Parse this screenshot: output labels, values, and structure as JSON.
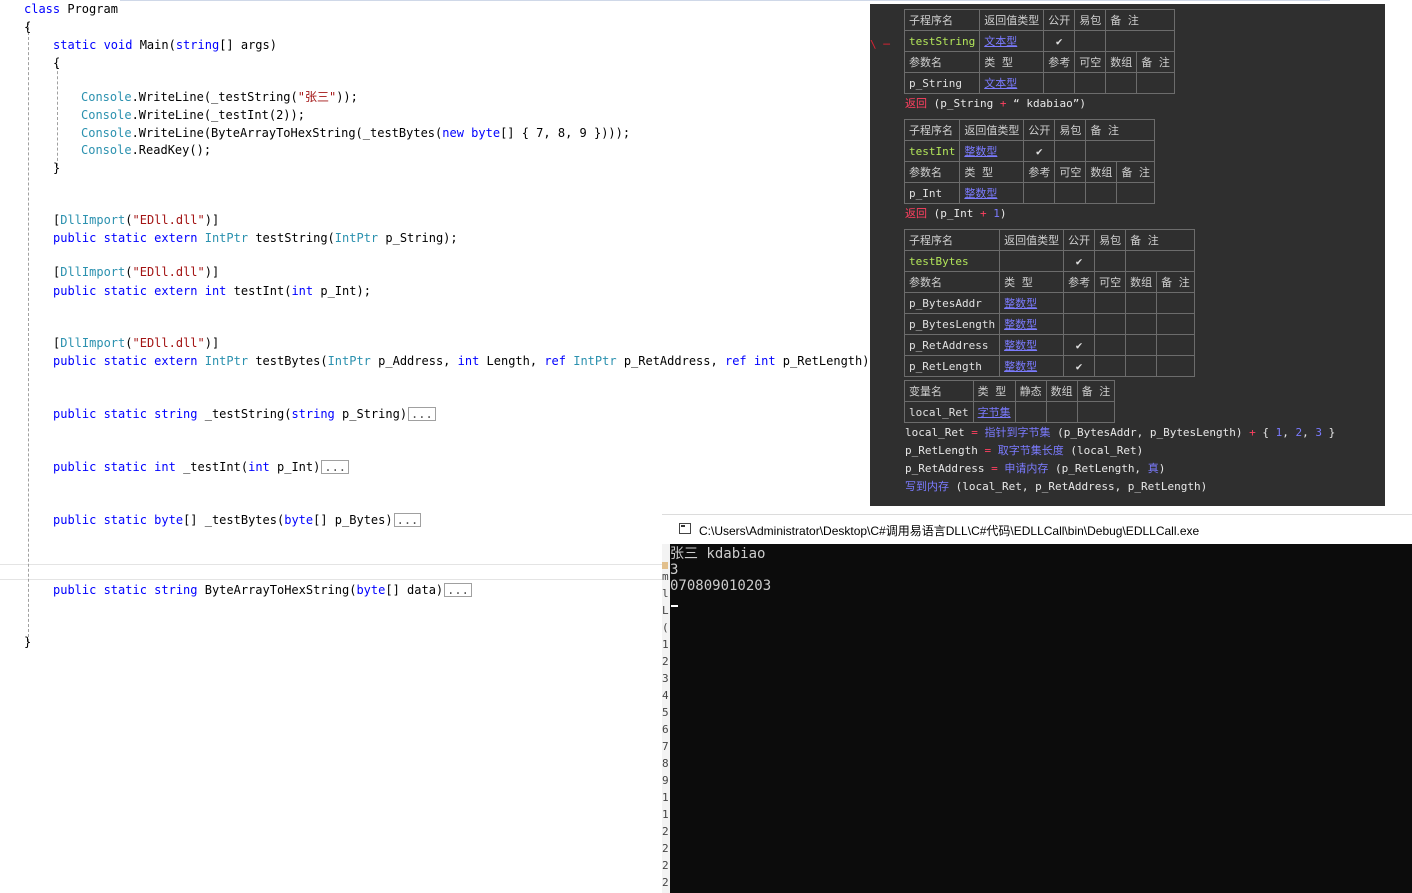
{
  "editor": {
    "lines": [
      {
        "indent": 0,
        "tokens": [
          [
            "kw",
            "class"
          ],
          [
            "",
            "Program"
          ]
        ]
      },
      {
        "indent": 0,
        "tokens": [
          [
            "",
            "{"
          ]
        ]
      },
      {
        "indent": 1,
        "tokens": [
          [
            "kw",
            "static"
          ],
          [
            "kw",
            "void"
          ],
          [
            "",
            "Main("
          ],
          [
            "kw",
            "string"
          ],
          [
            "",
            "[] args)"
          ]
        ]
      },
      {
        "indent": 1,
        "tokens": [
          [
            "",
            "{"
          ]
        ]
      },
      {
        "indent": 2,
        "tokens": [
          [
            "ty",
            "Console"
          ],
          [
            "",
            ".WriteLine(_testString("
          ],
          [
            "st",
            "\"张三\""
          ],
          [
            "",
            "));"
          ]
        ]
      },
      {
        "indent": 2,
        "tokens": [
          [
            "ty",
            "Console"
          ],
          [
            "",
            ".WriteLine(_testInt(2));"
          ]
        ]
      },
      {
        "indent": 2,
        "tokens": [
          [
            "ty",
            "Console"
          ],
          [
            "",
            ".WriteLine(ByteArrayToHexString(_testBytes("
          ],
          [
            "kw",
            "new"
          ],
          [
            "kw",
            "byte"
          ],
          [
            "",
            "[] { 7, 8, 9 })));"
          ]
        ]
      },
      {
        "indent": 2,
        "tokens": [
          [
            "ty",
            "Console"
          ],
          [
            "",
            ".ReadKey();"
          ]
        ]
      },
      {
        "indent": 1,
        "tokens": [
          [
            "",
            "}"
          ]
        ]
      },
      {
        "indent": 1,
        "tokens": [
          [
            "",
            "["
          ],
          [
            "ty",
            "DllImport"
          ],
          [
            "",
            "("
          ],
          [
            "st",
            "\"EDll.dll\""
          ],
          [
            "",
            ")]"
          ]
        ]
      },
      {
        "indent": 1,
        "tokens": [
          [
            "kw",
            "public"
          ],
          [
            "kw",
            "static"
          ],
          [
            "kw",
            "extern"
          ],
          [
            "ty",
            "IntPtr"
          ],
          [
            "",
            "testString("
          ],
          [
            "ty",
            "IntPtr"
          ],
          [
            "",
            "p_String);"
          ]
        ]
      },
      {
        "indent": 1,
        "tokens": [
          [
            "",
            "["
          ],
          [
            "ty",
            "DllImport"
          ],
          [
            "",
            "("
          ],
          [
            "st",
            "\"EDll.dll\""
          ],
          [
            "",
            ")]"
          ]
        ]
      },
      {
        "indent": 1,
        "tokens": [
          [
            "kw",
            "public"
          ],
          [
            "kw",
            "static"
          ],
          [
            "kw",
            "extern"
          ],
          [
            "kw",
            "int"
          ],
          [
            "",
            "testInt("
          ],
          [
            "kw",
            "int"
          ],
          [
            "",
            "p_Int);"
          ]
        ]
      },
      {
        "indent": 1,
        "tokens": [
          [
            "",
            "["
          ],
          [
            "ty",
            "DllImport"
          ],
          [
            "",
            "("
          ],
          [
            "st",
            "\"EDll.dll\""
          ],
          [
            "",
            ")]"
          ]
        ]
      },
      {
        "indent": 1,
        "tokens": [
          [
            "kw",
            "public"
          ],
          [
            "kw",
            "static"
          ],
          [
            "kw",
            "extern"
          ],
          [
            "ty",
            "IntPtr"
          ],
          [
            "",
            "testBytes("
          ],
          [
            "ty",
            "IntPtr"
          ],
          [
            "",
            "p_Address,"
          ],
          [
            "kw",
            "int"
          ],
          [
            "",
            "Length,"
          ],
          [
            "kw",
            "ref"
          ],
          [
            "ty",
            "IntPtr"
          ],
          [
            "",
            "p_RetAddress,"
          ],
          [
            "kw",
            "ref"
          ],
          [
            "kw",
            "int"
          ],
          [
            "",
            "p_RetLength);"
          ]
        ]
      },
      {
        "indent": 1,
        "collapsed": true,
        "tokens": [
          [
            "kw",
            "public"
          ],
          [
            "kw",
            "static"
          ],
          [
            "kw",
            "string"
          ],
          [
            "",
            "_testString("
          ],
          [
            "kw",
            "string"
          ],
          [
            "",
            "p_String)"
          ]
        ]
      },
      {
        "indent": 1,
        "collapsed": true,
        "tokens": [
          [
            "kw",
            "public"
          ],
          [
            "kw",
            "static"
          ],
          [
            "kw",
            "int"
          ],
          [
            "",
            "_testInt("
          ],
          [
            "kw",
            "int"
          ],
          [
            "",
            "p_Int)"
          ]
        ]
      },
      {
        "indent": 1,
        "collapsed": true,
        "tokens": [
          [
            "kw",
            "public"
          ],
          [
            "kw",
            "static"
          ],
          [
            "kw",
            "byte"
          ],
          [
            "",
            "[] _testBytes("
          ],
          [
            "kw",
            "byte"
          ],
          [
            "",
            "[] p_Bytes)"
          ]
        ]
      },
      {
        "indent": 1,
        "collapsed": true,
        "tokens": [
          [
            "kw",
            "public"
          ],
          [
            "kw",
            "static"
          ],
          [
            "kw",
            "string"
          ],
          [
            "",
            "ByteArrayToHexString("
          ],
          [
            "kw",
            "byte"
          ],
          [
            "",
            "[] data)"
          ]
        ]
      },
      {
        "indent": 0,
        "tokens": [
          [
            "",
            "}"
          ]
        ]
      }
    ],
    "collapsed_label": "..."
  },
  "elang": {
    "marker": "\\ ─",
    "tables": [
      {
        "rows": [
          [
            {
              "t": "子程序名",
              "c": "h"
            },
            {
              "t": "返回值类型",
              "c": "h"
            },
            {
              "t": "公开",
              "c": "h"
            },
            {
              "t": "易包",
              "c": "h"
            },
            {
              "t": "备 注",
              "c": "h"
            }
          ],
          [
            {
              "t": "testString",
              "c": "green"
            },
            {
              "t": "文本型",
              "c": "blue"
            },
            {
              "t": "✔",
              "c": "chk"
            },
            {
              "t": ""
            },
            {
              "t": ""
            }
          ],
          [
            {
              "t": "参数名",
              "c": "h"
            },
            {
              "t": "类 型",
              "c": "h"
            },
            {
              "t": "参考",
              "c": "h"
            },
            {
              "t": "可空",
              "c": "h"
            },
            {
              "t": "数组",
              "c": "h"
            },
            {
              "t": "备 注",
              "c": "h"
            }
          ],
          [
            {
              "t": "p_String"
            },
            {
              "t": "文本型",
              "c": "blue"
            },
            {
              "t": ""
            },
            {
              "t": ""
            },
            {
              "t": ""
            },
            {
              "t": ""
            }
          ]
        ]
      },
      {
        "rows": [
          [
            {
              "t": "子程序名",
              "c": "h"
            },
            {
              "t": "返回值类型",
              "c": "h"
            },
            {
              "t": "公开",
              "c": "h"
            },
            {
              "t": "易包",
              "c": "h"
            },
            {
              "t": "备 注",
              "c": "h"
            }
          ],
          [
            {
              "t": "testInt",
              "c": "green"
            },
            {
              "t": "整数型",
              "c": "blue"
            },
            {
              "t": "✔",
              "c": "chk"
            },
            {
              "t": ""
            },
            {
              "t": ""
            }
          ],
          [
            {
              "t": "参数名",
              "c": "h"
            },
            {
              "t": "类 型",
              "c": "h"
            },
            {
              "t": "参考",
              "c": "h"
            },
            {
              "t": "可空",
              "c": "h"
            },
            {
              "t": "数组",
              "c": "h"
            },
            {
              "t": "备 注",
              "c": "h"
            }
          ],
          [
            {
              "t": "p_Int"
            },
            {
              "t": "整数型",
              "c": "blue"
            },
            {
              "t": ""
            },
            {
              "t": ""
            },
            {
              "t": ""
            },
            {
              "t": ""
            }
          ]
        ]
      },
      {
        "rows": [
          [
            {
              "t": "子程序名",
              "c": "h"
            },
            {
              "t": "返回值类型",
              "c": "h"
            },
            {
              "t": "公开",
              "c": "h"
            },
            {
              "t": "易包",
              "c": "h"
            },
            {
              "t": "备 注",
              "c": "h"
            }
          ],
          [
            {
              "t": "testBytes",
              "c": "green"
            },
            {
              "t": ""
            },
            {
              "t": "✔",
              "c": "chk"
            },
            {
              "t": ""
            },
            {
              "t": ""
            }
          ],
          [
            {
              "t": "参数名",
              "c": "h"
            },
            {
              "t": "类 型",
              "c": "h"
            },
            {
              "t": "参考",
              "c": "h"
            },
            {
              "t": "可空",
              "c": "h"
            },
            {
              "t": "数组",
              "c": "h"
            },
            {
              "t": "备 注",
              "c": "h"
            }
          ],
          [
            {
              "t": "p_BytesAddr"
            },
            {
              "t": "整数型",
              "c": "blue"
            },
            {
              "t": ""
            },
            {
              "t": ""
            },
            {
              "t": ""
            },
            {
              "t": ""
            }
          ],
          [
            {
              "t": "p_BytesLength"
            },
            {
              "t": "整数型",
              "c": "blue"
            },
            {
              "t": ""
            },
            {
              "t": ""
            },
            {
              "t": ""
            },
            {
              "t": ""
            }
          ],
          [
            {
              "t": "p_RetAddress"
            },
            {
              "t": "整数型",
              "c": "blue"
            },
            {
              "t": "✔",
              "c": "chk"
            },
            {
              "t": ""
            },
            {
              "t": ""
            },
            {
              "t": ""
            }
          ],
          [
            {
              "t": "p_RetLength"
            },
            {
              "t": "整数型",
              "c": "blue"
            },
            {
              "t": "✔",
              "c": "chk"
            },
            {
              "t": ""
            },
            {
              "t": ""
            },
            {
              "t": ""
            }
          ]
        ]
      },
      {
        "rows": [
          [
            {
              "t": "变量名",
              "c": "h"
            },
            {
              "t": "类 型",
              "c": "h"
            },
            {
              "t": "静态",
              "c": "h"
            },
            {
              "t": "数组",
              "c": "h"
            },
            {
              "t": "备 注",
              "c": "h"
            }
          ],
          [
            {
              "t": "local_Ret"
            },
            {
              "t": "字节集",
              "c": "blue"
            },
            {
              "t": ""
            },
            {
              "t": ""
            },
            {
              "t": ""
            }
          ]
        ]
      }
    ],
    "code": [
      [
        [
          "ret",
          "返回"
        ],
        [
          "",
          " (p_String "
        ],
        [
          "op",
          "+"
        ],
        [
          "",
          " “ kdabiao”)"
        ]
      ],
      [
        [
          "ret",
          "返回"
        ],
        [
          "",
          " (p_Int "
        ],
        [
          "op",
          "+"
        ],
        [
          "",
          " "
        ],
        [
          "nm",
          "1"
        ],
        [
          "",
          ")"
        ]
      ],
      [
        [
          "",
          "local_Ret "
        ],
        [
          "op",
          "="
        ],
        [
          "",
          " "
        ],
        [
          "pb",
          "指针到字节集"
        ],
        [
          "",
          " (p_BytesAddr, p_BytesLength) "
        ],
        [
          "op",
          "+"
        ],
        [
          "",
          " { "
        ],
        [
          "nm",
          "1"
        ],
        [
          "",
          ", "
        ],
        [
          "nm",
          "2"
        ],
        [
          "",
          ", "
        ],
        [
          "nm",
          "3"
        ],
        [
          "",
          " }"
        ]
      ],
      [
        [
          "",
          "p_RetLength "
        ],
        [
          "op",
          "="
        ],
        [
          "",
          " "
        ],
        [
          "pb",
          "取字节集长度"
        ],
        [
          "",
          " (local_Ret)"
        ]
      ],
      [
        [
          "",
          "p_RetAddress "
        ],
        [
          "op",
          "="
        ],
        [
          "",
          " "
        ],
        [
          "pb",
          "申请内存"
        ],
        [
          "",
          " (p_RetLength, "
        ],
        [
          "pb",
          "真"
        ],
        [
          "",
          ")"
        ]
      ],
      [
        [
          "pb",
          "写到内存"
        ],
        [
          "",
          " (local_Ret, p_RetAddress, p_RetLength)"
        ]
      ]
    ]
  },
  "console": {
    "title": "C:\\Users\\Administrator\\Desktop\\C#调用易语言DLL\\C#代码\\EDLLCall\\bin\\Debug\\EDLLCall.exe",
    "output": [
      "张三 kdabiao",
      "3",
      "070809010203"
    ],
    "edge_chars": [
      "m",
      "l",
      "L",
      "(",
      "1",
      "2",
      "3",
      "4",
      "5",
      "6",
      "7",
      "8",
      "9",
      "1",
      "1",
      "2",
      "2",
      "2",
      "2",
      "2"
    ]
  },
  "colors": {
    "keyword": "#0000ff",
    "type": "#2b91af",
    "string": "#a31515",
    "elang_bg": "#2f2f2f",
    "elang_name": "#b3e65a",
    "elang_type": "#7b7bff",
    "elang_keyword": "#ff4060",
    "console_bg": "#0c0c0c",
    "console_text": "#cccccc"
  }
}
